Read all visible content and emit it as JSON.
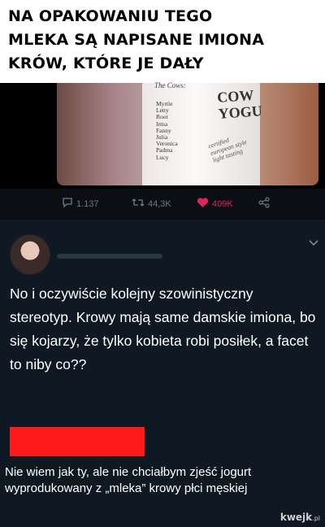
{
  "header": {
    "lines": [
      "NA OPAKOWANIU TEGO",
      "MLEKA SĄ NAPISANE IMIONA",
      "KRÓW, KTÓRE JE DAŁY"
    ]
  },
  "photo": {
    "cows_title": "The Cows:",
    "cow_names": [
      "Myrtle",
      "Letty",
      "Root",
      "Irma",
      "Fanny",
      "Julia",
      "Veronica",
      "Padma",
      "Lucy"
    ],
    "brand_lines": [
      "COW",
      "YOGU"
    ],
    "fine_print": [
      "certified",
      "european style",
      "light tasting"
    ]
  },
  "tweet_actions": {
    "replies": "1.137",
    "retweets": "44,3K",
    "likes": "409K",
    "reply_icon": "comment-icon",
    "retweet_icon": "retweet-icon",
    "like_icon": "heart-icon",
    "share_icon": "share-icon",
    "like_color": "#e0245e"
  },
  "reply_tweet": {
    "text": "No i oczywiście kolejny szowinistyczny stereotyp. Krowy mają same damskie imiona, bo się kojarzy, że tylko kobieta robi posiłek, a facet to niby co??",
    "menu_icon": "chevron-down-icon"
  },
  "response": {
    "censor_color": "#ff1a1a",
    "text": "Nie wiem jak ty, ale nie chciałbym zjeść jogurt wyprodukowany z „mleka” krowy płci męskiej"
  },
  "watermark": {
    "brand": "kwejk",
    "tld": ".pl"
  }
}
